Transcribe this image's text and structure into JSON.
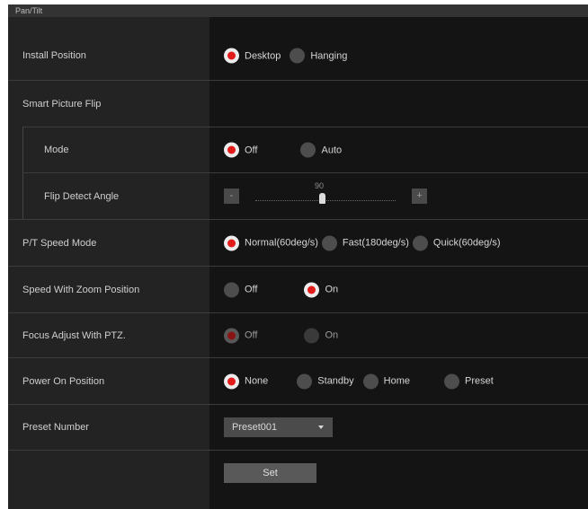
{
  "window": {
    "title": "Pan/Tilt"
  },
  "install_position": {
    "label": "Install Position",
    "options": [
      "Desktop",
      "Hanging"
    ],
    "selected": "Desktop"
  },
  "smart_picture_flip": {
    "label": "Smart Picture Flip",
    "mode": {
      "label": "Mode",
      "options": [
        "Off",
        "Auto"
      ],
      "selected": "Off"
    },
    "flip_detect_angle": {
      "label": "Flip Detect Angle",
      "value": "90",
      "minus": "-",
      "plus": "+"
    }
  },
  "pt_speed_mode": {
    "label": "P/T Speed Mode",
    "options": [
      "Normal(60deg/s)",
      "Fast(180deg/s)",
      "Quick(60deg/s)"
    ],
    "selected": "Normal(60deg/s)"
  },
  "speed_with_zoom": {
    "label": "Speed With Zoom Position",
    "options": [
      "Off",
      "On"
    ],
    "selected": "On"
  },
  "focus_adjust_ptz": {
    "label": "Focus Adjust With PTZ.",
    "options": [
      "Off",
      "On"
    ],
    "selected": "Off",
    "disabled": true
  },
  "power_on_position": {
    "label": "Power On Position",
    "options": [
      "None",
      "Standby",
      "Home",
      "Preset"
    ],
    "selected": "None"
  },
  "preset_number": {
    "label": "Preset Number",
    "value": "Preset001"
  },
  "set_button": {
    "label": "Set"
  },
  "colors": {
    "panel_bg": "#141414",
    "label_col_bg": "#232323",
    "radio_selected": "#e21b1b",
    "radio_unselected": "#4d4d4d"
  }
}
